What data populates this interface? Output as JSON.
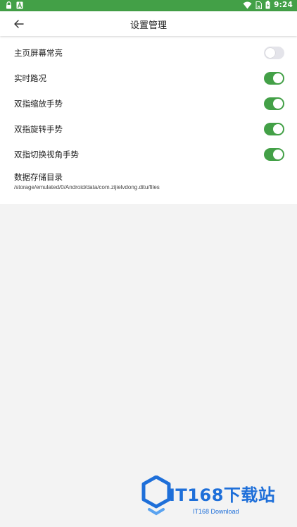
{
  "status_bar": {
    "time": "9:24",
    "left_icons": [
      "lock-icon",
      "a-icon"
    ],
    "right_icons": [
      "wifi-icon",
      "sim-icon",
      "battery-icon"
    ],
    "background": "#43a047"
  },
  "header": {
    "back_icon": "back-arrow-icon",
    "title": "设置管理"
  },
  "settings": [
    {
      "label": "主页屏幕常亮",
      "enabled": false
    },
    {
      "label": "实时路况",
      "enabled": true
    },
    {
      "label": "双指缩放手势",
      "enabled": true
    },
    {
      "label": "双指旋转手势",
      "enabled": true
    },
    {
      "label": "双指切换视角手势",
      "enabled": true
    }
  ],
  "storage": {
    "title": "数据存储目录",
    "path": "/storage/emulated/0/Android/data/com.zijielvdong.ditu/files"
  },
  "watermark": {
    "main_text": "IT168下载站",
    "sub_text": "IT168 Download",
    "color": "#1e6fd9"
  },
  "colors": {
    "accent": "#43a047",
    "toggle_off": "#e4e4ea",
    "background": "#f3f3f3"
  }
}
